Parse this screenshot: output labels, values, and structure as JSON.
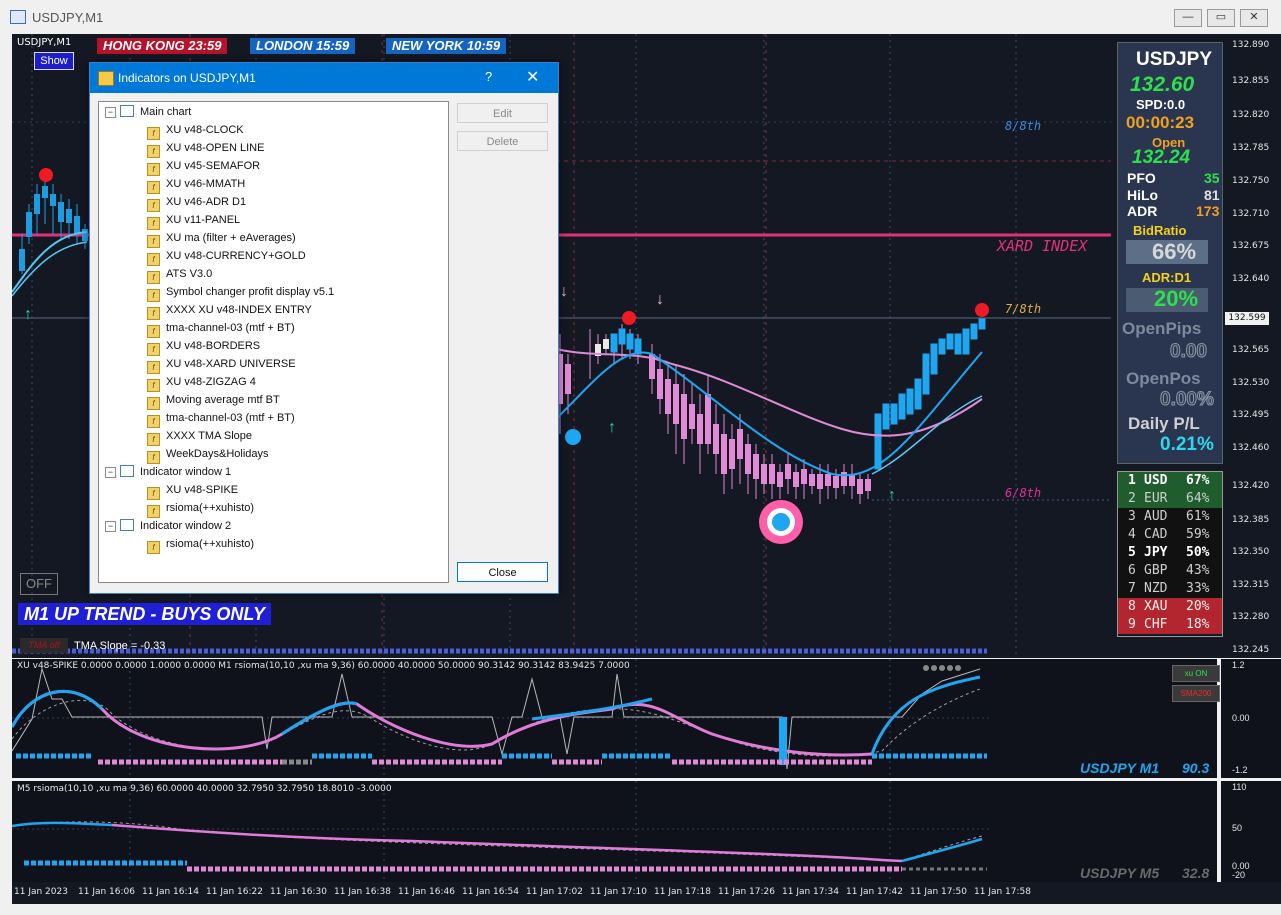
{
  "window": {
    "title": "USDJPY,M1",
    "min": "—",
    "restore": "▭",
    "close": "✕"
  },
  "chart": {
    "symbol_label": "USDJPY,M1",
    "show_button": "Show",
    "sessions": [
      {
        "label": "HONG KONG 23:59",
        "color": "#b5122b"
      },
      {
        "label": "LONDON  15:59",
        "color": "#1565c0"
      },
      {
        "label": "NEW YORK  10:59",
        "color": "#1565c0"
      }
    ],
    "levels": {
      "l8": "8/8th",
      "l7": "7/8th",
      "l6": "6/8th",
      "xard": "XARD INDEX"
    },
    "trend_banner": "M1 UP TREND - BUYS ONLY",
    "off_button": "OFF",
    "tma_button": "TMA off",
    "tma_slope": "TMA Slope = -0.33",
    "current_price": "132.599",
    "price_ticks": [
      "132.890",
      "132.855",
      "132.820",
      "132.785",
      "132.750",
      "132.710",
      "132.675",
      "132.640",
      "132.599",
      "132.565",
      "132.530",
      "132.495",
      "132.460",
      "132.420",
      "132.385",
      "132.350",
      "132.315",
      "132.280",
      "132.245"
    ]
  },
  "dialog": {
    "title": "Indicators on USDJPY,M1",
    "help": "?",
    "close_x": "✕",
    "main_chart": "Main chart",
    "main_items": [
      "XU v48-CLOCK",
      "XU v48-OPEN LINE",
      "XU v45-SEMAFOR",
      "XU v46-MMATH",
      "XU v46-ADR D1",
      "XU v11-PANEL",
      "XU ma (filter + eAverages)",
      "XU v48-CURRENCY+GOLD",
      "ATS V3.0",
      "Symbol changer profit display v5.1",
      "XXXX XU v48-INDEX ENTRY",
      "tma-channel-03 (mtf + BT)",
      "XU v48-BORDERS",
      "XU v48-XARD UNIVERSE",
      "XU v48-ZIGZAG 4",
      "Moving average mtf BT",
      "tma-channel-03 (mtf + BT)",
      "XXXX TMA Slope",
      "WeekDays&Holidays"
    ],
    "window1": "Indicator window 1",
    "window1_items": [
      "XU v48-SPIKE",
      "rsioma(++xuhisto)"
    ],
    "window2": "Indicator window 2",
    "window2_items": [
      "rsioma(++xuhisto)"
    ],
    "edit": "Edit",
    "delete": "Delete",
    "close": "Close"
  },
  "panel": {
    "symbol": "USDJPY",
    "price": "132.60",
    "spread": "SPD:0.0",
    "timer": "00:00:23",
    "open_label": "Open",
    "open_value": "132.24",
    "pfo_label": "PFO",
    "pfo_value": "35",
    "hilo_label": "HiLo",
    "hilo_value": "81",
    "adr_label": "ADR",
    "adr_value": "173",
    "bidratio_label": "BidRatio",
    "bidratio_value": "66%",
    "adrd1_label": "ADR:D1",
    "adrd1_value": "20%",
    "openpips_label": "OpenPips",
    "openpips_value": "0.00",
    "openpos_label": "OpenPos",
    "openpos_value": "0.00%",
    "dailypl_label": "Daily P/L",
    "dailypl_value": "0.21%"
  },
  "currency_strength": [
    {
      "rank": "1",
      "ccy": "USD",
      "pct": "67%",
      "bg": "#1f5d2c",
      "fg": "#ffffff",
      "bold": true
    },
    {
      "rank": "2",
      "ccy": "EUR",
      "pct": "64%",
      "bg": "#1f5d2c",
      "fg": "#cfcfcf",
      "bold": false
    },
    {
      "rank": "3",
      "ccy": "AUD",
      "pct": "61%",
      "bg": "#111111",
      "fg": "#cfcfcf",
      "bold": false
    },
    {
      "rank": "4",
      "ccy": "CAD",
      "pct": "59%",
      "bg": "#111111",
      "fg": "#cfcfcf",
      "bold": false
    },
    {
      "rank": "5",
      "ccy": "JPY",
      "pct": "50%",
      "bg": "#111111",
      "fg": "#ffffff",
      "bold": true
    },
    {
      "rank": "6",
      "ccy": "GBP",
      "pct": "43%",
      "bg": "#111111",
      "fg": "#cfcfcf",
      "bold": false
    },
    {
      "rank": "7",
      "ccy": "NZD",
      "pct": "33%",
      "bg": "#111111",
      "fg": "#cfcfcf",
      "bold": false
    },
    {
      "rank": "8",
      "ccy": "XAU",
      "pct": "20%",
      "bg": "#b3262f",
      "fg": "#f2f2f2",
      "bold": false
    },
    {
      "rank": "9",
      "ccy": "CHF",
      "pct": "18%",
      "bg": "#b3262f",
      "fg": "#f2f2f2",
      "bold": false
    }
  ],
  "sub1": {
    "caption": "XU v48-SPIKE 0.0000 0.0000 1.0000 0.0000  M1  rsioma(10,10 ,xu ma 9,36) 60.0000 40.0000 50.0000 90.3142 90.3142 83.9425 7.0000",
    "xu_on": "xu ON",
    "sma200": "SMA200",
    "label": "USDJPY M1",
    "value": "90.3",
    "scale": [
      "1.2",
      "0.00",
      "-1.2"
    ]
  },
  "sub2": {
    "caption": "M5  rsioma(10,10 ,xu ma 9,36) 60.0000 40.0000 32.7950 32.7950 18.8010 -3.0000",
    "label": "USDJPY M5",
    "value": "32.8",
    "scale": [
      "110",
      "50",
      "0.00",
      "-20"
    ]
  },
  "time_axis": [
    "11 Jan 2023",
    "11 Jan 16:06",
    "11 Jan 16:14",
    "11 Jan 16:22",
    "11 Jan 16:30",
    "11 Jan 16:38",
    "11 Jan 16:46",
    "11 Jan 16:54",
    "11 Jan 17:02",
    "11 Jan 17:10",
    "11 Jan 17:18",
    "11 Jan 17:26",
    "11 Jan 17:34",
    "11 Jan 17:42",
    "11 Jan 17:50",
    "11 Jan 17:58"
  ]
}
